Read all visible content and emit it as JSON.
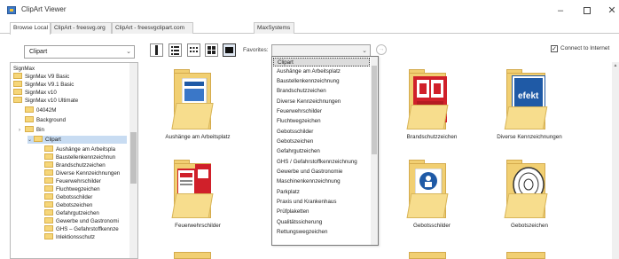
{
  "window": {
    "title": "ClipArt Viewer",
    "min_label": "–",
    "close_label": "✕"
  },
  "tabs": [
    {
      "label": "Browse Local"
    },
    {
      "label": "ClipArt - freesvg.org"
    },
    {
      "label": "ClipArt - freesvgclipart.com"
    },
    {
      "label": "MaxSystems"
    }
  ],
  "toolbar": {
    "library_value": "Clipart",
    "favorites_label": "Favorites:",
    "favorites_value": "",
    "connect_label": "Connect to Internet",
    "connect_checked": "✓"
  },
  "tree": {
    "items": [
      {
        "label": "SignMax"
      },
      {
        "label": "SignMax V9 Basic"
      },
      {
        "label": "SignMax V9.1 Basic"
      },
      {
        "label": "SignMax v10"
      },
      {
        "label": "SignMax v10 Ultimate"
      },
      {
        "label": "04042M"
      },
      {
        "label": "Background"
      },
      {
        "label": "Bin"
      },
      {
        "label": "Clipart"
      },
      {
        "label": "Aushänge am Arbeitspla"
      },
      {
        "label": "Baustellenkennzeichnun"
      },
      {
        "label": "Brandschutzzeichen"
      },
      {
        "label": "Diverse Kennzeichnungen"
      },
      {
        "label": "Feuerwehrschilder"
      },
      {
        "label": "Fluchtwegzeichen"
      },
      {
        "label": "Gebotsschilder"
      },
      {
        "label": "Gebotszeichen"
      },
      {
        "label": "Gefahrgutzeichen"
      },
      {
        "label": "Gewerbe und Gastronomi"
      },
      {
        "label": "GHS – Gefahrstoffkennze"
      },
      {
        "label": "Inlektionsschutz"
      }
    ]
  },
  "grid": {
    "items": [
      {
        "label": "Aushänge am Arbeitsplatz"
      },
      {
        "label": "Brandschutzzeichen"
      },
      {
        "label": "Diverse Kennzeichnungen"
      },
      {
        "label": "Feuerwehrschilder"
      },
      {
        "label": "Gebotsschilder"
      },
      {
        "label": "Gebotszeichen"
      }
    ],
    "icon_text": {
      "efekt": "efekt"
    }
  },
  "dropdown": {
    "items": [
      {
        "label": "Clipart"
      },
      {
        "label": "Aushänge am Arbeitsplatz"
      },
      {
        "label": "Baustellenkennzeichnung"
      },
      {
        "label": "Brandschutzzeichen"
      },
      {
        "label": "Diverse Kennzeichnungen"
      },
      {
        "label": "Feuerwehrschilder"
      },
      {
        "label": "Fluchtwegzeichen"
      },
      {
        "label": "Gebotsschilder"
      },
      {
        "label": "Gebotszeichen"
      },
      {
        "label": "Gefahrgutzeichen"
      },
      {
        "label": "GHS / Gefahrstoffkennzeichnung"
      },
      {
        "label": "Gewerbe und Gastronomie"
      },
      {
        "label": "Maschinenkennzeichnung"
      },
      {
        "label": "Parkplatz"
      },
      {
        "label": "Praxis und Krankenhaus"
      },
      {
        "label": "Prüfplaketten"
      },
      {
        "label": "Qualitätssicherung"
      },
      {
        "label": "Rettungswegzeichen"
      }
    ]
  },
  "colors": {
    "folder": "#f1cf72",
    "selection": "#c8dcf2",
    "accent_red": "#d0202a",
    "accent_blue": "#1f5aa6"
  }
}
